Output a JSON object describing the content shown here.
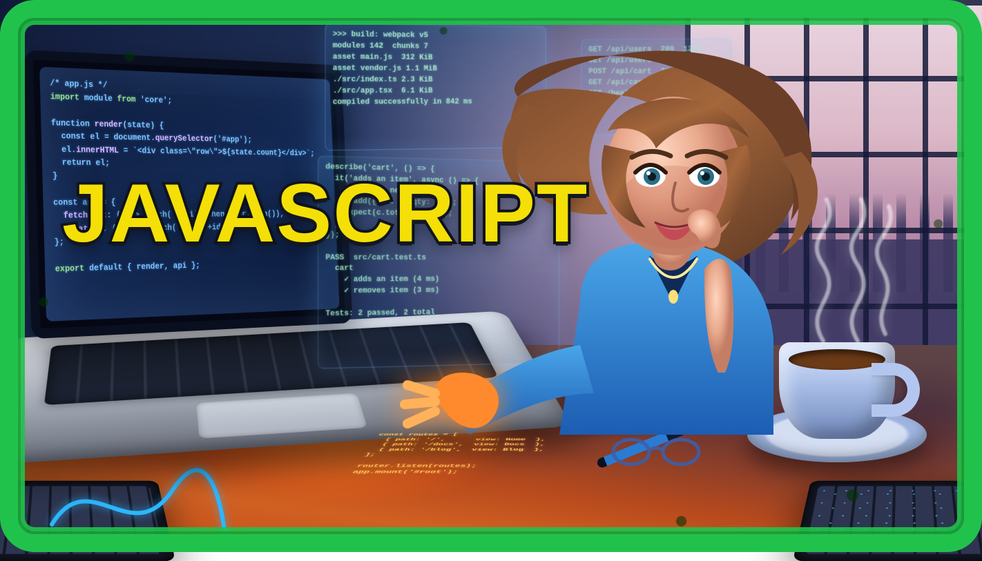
{
  "title": "JAVASCRIPT",
  "screen_code": "/* app.js */\n<import> module <from> 'core';\n\nfunction <render>(state) {\n  const el = document.<querySelector>('#app');\n  el.<innerHTML> = `<div class=\\\"row\\\">${state.count}</div>`;\n  return el;\n}\n\nconst api = {\n  <fetchList>: () => fetch('/api').then(r=>r.json()),\n  <update>  : (id) => patch('/api/'+id)\n};\n\n<export> default { render, api };",
  "holo1": ">>> build: webpack v5\nmodules 142  chunks 7\nasset main.js  312 KiB\nasset vendor.js 1.1 MiB\n./src/index.ts 2.3 KiB\n./src/app.tsx  6.1 KiB\ncompiled successfully in 842 ms",
  "holo2": "describe('cart', () => {\n  it('adds an item', async () => {\n    const c = new Cart();\n    c.add({ id: 1, qty: 2 });\n    expect(c.total).toBe(2);\n  });\n});\n\nPASS  src/cart.test.ts\n  cart\n    ✓ adds an item (4 ms)\n    ✓ removes item (3 ms)\n\nTests: 2 passed, 2 total",
  "holo3": "GET /api/users  200  12ms\nGET /api/users  200  11ms\nPOST /api/cart  201  42ms\nGET /api/cart   200   9ms\nGET /health     200   2ms",
  "desk_code": "const routes = [\n  { path: '/',      view: Home  },\n  { path: '/docs',  view: Docs  },\n  { path: '/blog',  view: Blog  },\n];\n\nrouter.listen(routes);\napp.mount('#root');"
}
